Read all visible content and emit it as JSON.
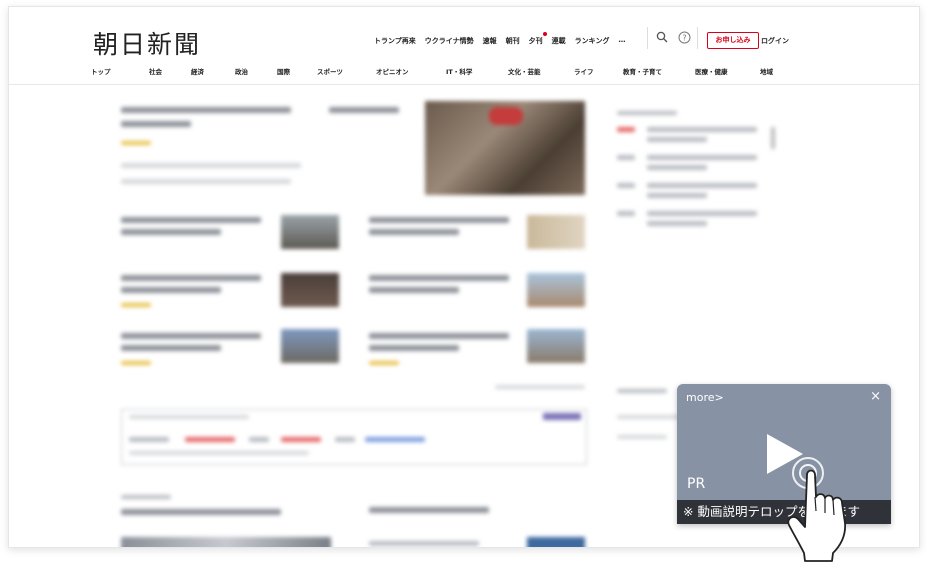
{
  "header": {
    "logo": "朝日新聞",
    "top_links": [
      "トランプ再来",
      "ウクライナ情勢",
      "速報",
      "朝刊",
      "夕刊",
      "連載",
      "ランキング",
      "…"
    ],
    "apply_button": "お申し込み",
    "login": "ログイン"
  },
  "nav": {
    "items": [
      "トップ",
      "社会",
      "経済",
      "政治",
      "国際",
      "スポーツ",
      "オピニオン",
      "IT・科学",
      "文化・芸能",
      "ライフ",
      "教育・子育て",
      "医療・健康",
      "地域"
    ]
  },
  "pr_overlay": {
    "more": "more>",
    "close": "×",
    "label": "PR",
    "caption": "※ 動画説明テロップを入れます"
  },
  "icons": {
    "search": "search-icon",
    "help": "help-icon",
    "play": "play-icon",
    "hand": "hand-pointer-icon"
  },
  "colors": {
    "accent_red": "#d9001b",
    "pr_background": "#8793a4",
    "caption_background": "#2f3238"
  }
}
